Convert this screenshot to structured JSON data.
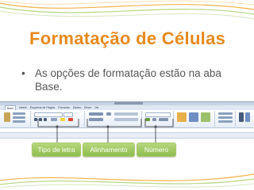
{
  "slide": {
    "title": "Formatação de Células",
    "bullet_marker": "•",
    "bullet_text": "As opções de formatação estão na aba Base."
  },
  "ribbon_tabs": [
    "Base",
    "Inserir",
    "Esquema de Página",
    "Fórmulas",
    "Dados",
    "Rever",
    "Ver"
  ],
  "callouts": {
    "font_label": "Tipo de letra",
    "alignment_label": "Alinhamento",
    "number_label": "Número"
  },
  "colors": {
    "title": "#e8891c",
    "callout_green": "#8fbd4d",
    "accent_line_green": "#b6d77e",
    "accent_line_orange": "#f2b34a"
  }
}
